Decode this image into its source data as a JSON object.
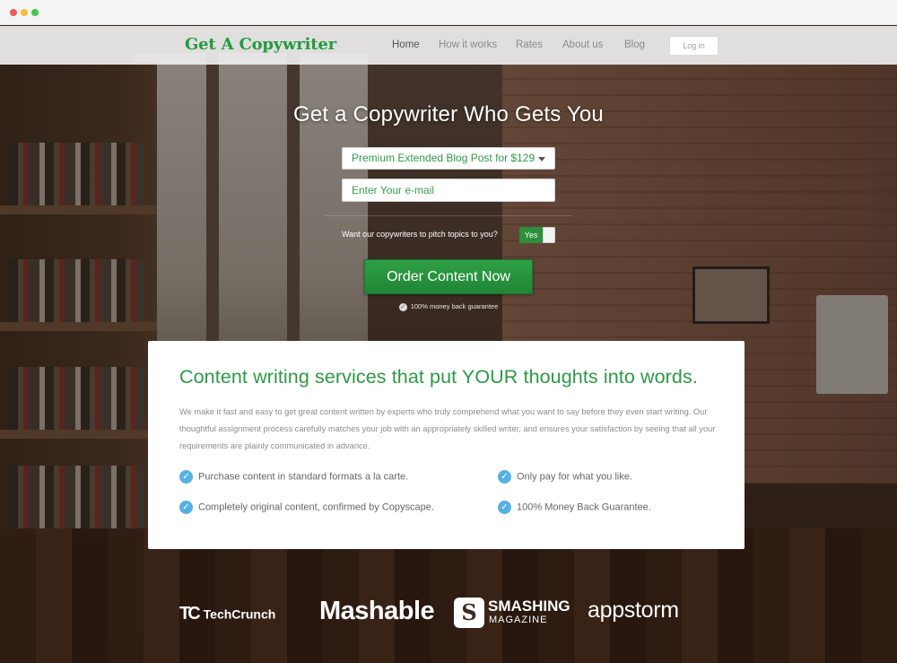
{
  "header": {
    "logo": "Get A Copywriter",
    "nav": [
      "Home",
      "How it works",
      "Rates",
      "About us",
      "Blog"
    ],
    "login": "Log in"
  },
  "hero": {
    "title": "Get a Copywriter Who Gets You",
    "select_value": "Premium Extended Blog Post for $129",
    "email_placeholder": "Enter Your e-mail",
    "pitch_question": "Want our copywriters to pitch topics to you?",
    "toggle_label": "Yes",
    "order_button": "Order Content Now",
    "guarantee": "100% money back guarantee"
  },
  "card": {
    "title": "Content writing services that put YOUR thoughts into words.",
    "body": "We make it fast and easy to get great content written by experts who truly comprehend what you want to say before they even start writing. Our thoughtful assignment process carefully matches your job  with an appropriately skilled writer, and ensures your satisfaction by seeing that all your requirements are plainly communicated in advance.",
    "features": [
      "Purchase content in standard formats a la carte.",
      "Only pay for what you like.",
      "Completely original content, confirmed by Copyscape.",
      "100% Money Back Guarantee."
    ]
  },
  "press": {
    "techcrunch": "TechCrunch",
    "mashable": "Mashable",
    "smashing_1": "SMASHING",
    "smashing_2": "MAGAZINE",
    "appstorm": "appstorm"
  },
  "colors": {
    "brand_green": "#249a3e",
    "check_blue": "#56b1e3"
  }
}
